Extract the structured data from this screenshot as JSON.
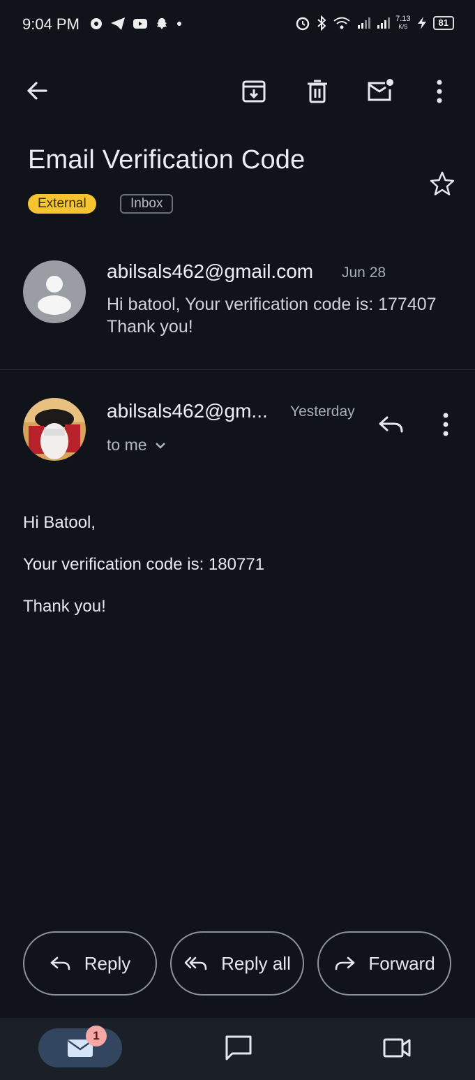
{
  "status_bar": {
    "time": "9:04 PM",
    "net_speed": "7.13",
    "net_unit": "K/S",
    "battery": "81"
  },
  "toolbar": {
    "back": "arrow-left-icon",
    "archive": "archive-icon",
    "delete": "trash-icon",
    "mark_unread": "mail-unread-icon",
    "more": "more-vert-icon"
  },
  "thread": {
    "subject": "Email Verification Code",
    "labels": [
      "External",
      "Inbox"
    ]
  },
  "collapsed_message": {
    "sender": "abilsals462@gmail.com",
    "date": "Jun 28",
    "snippet": "Hi batool, Your verification code is: 177407 Thank you!"
  },
  "expanded_message": {
    "sender": "abilsals462@gm...",
    "date": "Yesterday",
    "recipient": "to me",
    "body": [
      "Hi Batool,",
      "Your verification code is: 180771",
      "Thank you!"
    ]
  },
  "actions": {
    "reply": "Reply",
    "reply_all": "Reply all",
    "forward": "Forward"
  },
  "bottom_nav": {
    "mail_badge": "1",
    "items": [
      "mail-icon",
      "chat-icon",
      "video-icon"
    ]
  },
  "colors": {
    "background": "#10131a",
    "external_chip": "#f6c431",
    "nav_active": "#32465f",
    "badge": "#f4a9a6"
  }
}
